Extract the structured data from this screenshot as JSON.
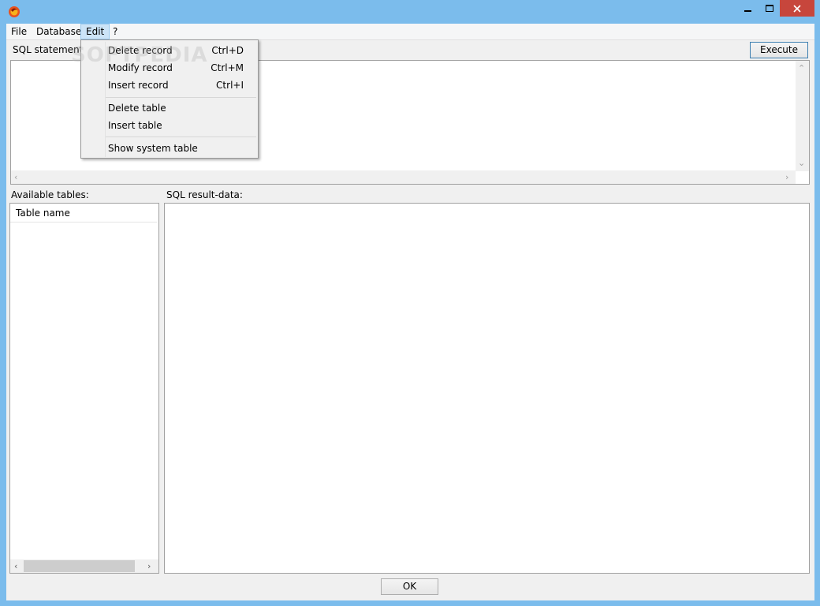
{
  "window": {
    "controls": {
      "minimize_icon": "minimize-icon",
      "maximize_icon": "maximize-icon",
      "close_icon": "close-icon"
    }
  },
  "menubar": {
    "items": [
      {
        "label": "File"
      },
      {
        "label": "Database"
      },
      {
        "label": "Edit"
      },
      {
        "label": "?"
      }
    ]
  },
  "sql": {
    "label": "SQL statement:",
    "execute_label": "Execute",
    "value": ""
  },
  "edit_menu": {
    "items": [
      {
        "label": "Delete record",
        "shortcut": "Ctrl+D"
      },
      {
        "label": "Modify record",
        "shortcut": "Ctrl+M"
      },
      {
        "label": "Insert record",
        "shortcut": "Ctrl+I"
      },
      {
        "label": "Delete table",
        "shortcut": ""
      },
      {
        "label": "Insert table",
        "shortcut": ""
      },
      {
        "label": "Show system table",
        "shortcut": ""
      }
    ]
  },
  "tables": {
    "label": "Available tables:",
    "column_header": "Table name",
    "rows": []
  },
  "results": {
    "label": "SQL result-data:"
  },
  "footer": {
    "ok_label": "OK"
  },
  "watermark": "SOFTPEDIA",
  "colors": {
    "titlebar": "#7bbcec",
    "close": "#c7463c",
    "menu_active": "#cce4f7"
  }
}
